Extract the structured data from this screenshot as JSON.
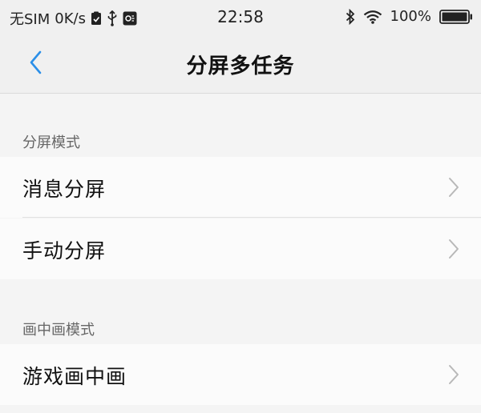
{
  "status_bar": {
    "sim_text": "无SIM",
    "speed_text": "0K/s",
    "time": "22:58",
    "battery_text": "100%"
  },
  "header": {
    "title": "分屏多任务"
  },
  "sections": [
    {
      "label": "分屏模式",
      "items": [
        {
          "label": "消息分屏"
        },
        {
          "label": "手动分屏"
        }
      ]
    },
    {
      "label": "画中画模式",
      "items": [
        {
          "label": "游戏画中画"
        }
      ]
    }
  ],
  "colors": {
    "accent": "#2b8fe8",
    "background": "#f4f4f4",
    "row_background": "#fbfbfb"
  }
}
